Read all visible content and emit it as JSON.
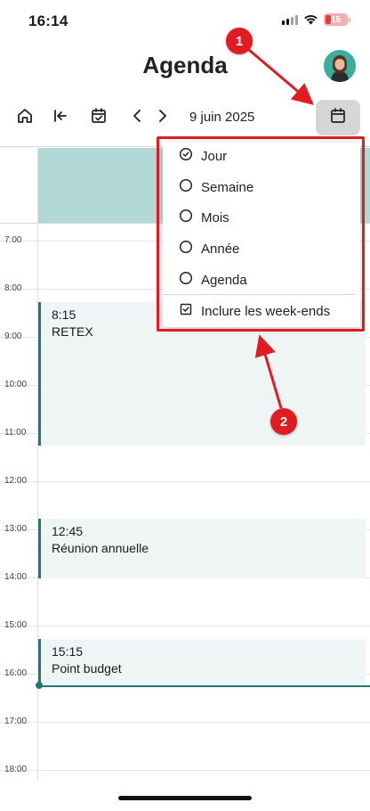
{
  "status_bar": {
    "time": "16:14",
    "battery": "15"
  },
  "header": {
    "title": "Agenda"
  },
  "toolbar": {
    "home_icon": "home-icon",
    "first_icon": "first-page-icon",
    "today_icon": "calendar-check-icon",
    "prev_icon": "chevron-left-icon",
    "next_icon": "chevron-right-icon",
    "date": "9 juin 2025",
    "view_icon": "calendar-icon"
  },
  "hours": [
    "7:00",
    "8:00",
    "9:00",
    "10:00",
    "11:00",
    "12:00",
    "13:00",
    "14:00",
    "15:00",
    "16:00",
    "17:00",
    "18:00"
  ],
  "events": [
    {
      "time": "8:15",
      "title": "RETEX"
    },
    {
      "time": "12:45",
      "title": "Réunion annuelle"
    },
    {
      "time": "15:15",
      "title": "Point budget"
    }
  ],
  "menu": {
    "items": [
      {
        "label": "Jour",
        "selected": true
      },
      {
        "label": "Semaine",
        "selected": false
      },
      {
        "label": "Mois",
        "selected": false
      },
      {
        "label": "Année",
        "selected": false
      },
      {
        "label": "Agenda",
        "selected": false
      }
    ],
    "weekend_label": "Inclure les week-ends",
    "weekend_checked": true
  },
  "annotations": {
    "badge_1": "1",
    "badge_2": "2",
    "color": "#e01b22"
  },
  "colors": {
    "accent": "#1f7a74",
    "day_header": "#b3d9d7",
    "event_bg": "#eef5f4"
  }
}
